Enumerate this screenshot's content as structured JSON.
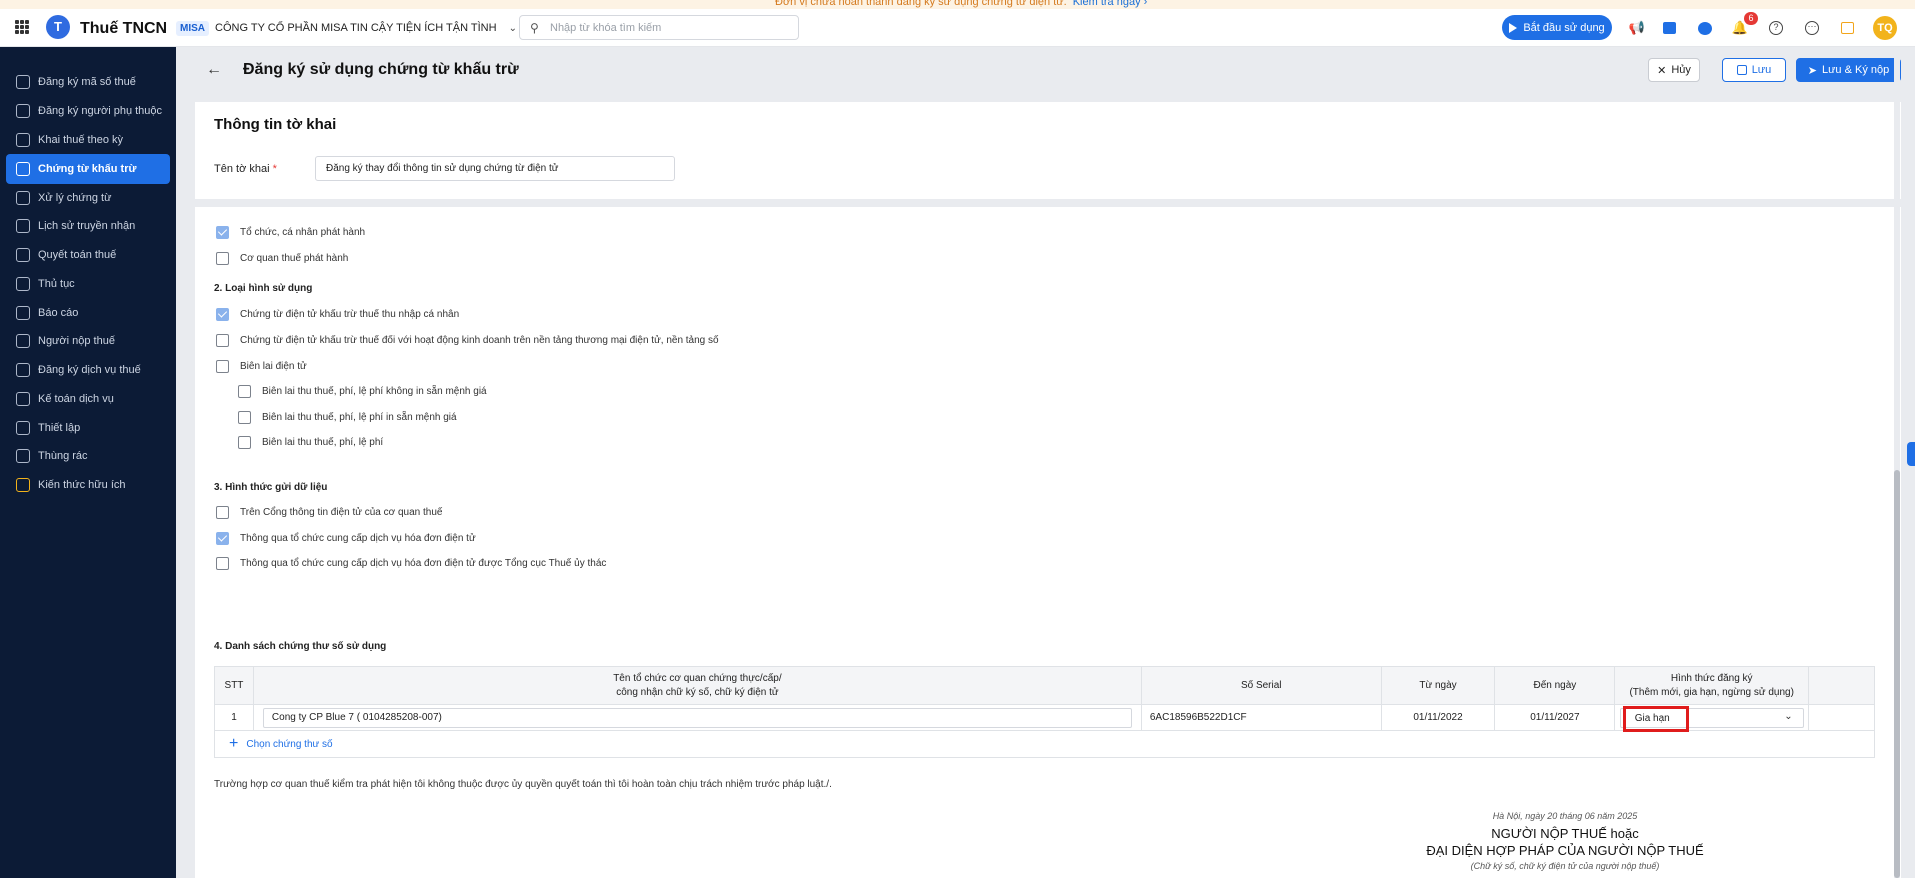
{
  "notice": {
    "text": "Đơn vị chưa hoàn thành đăng ký sử dụng chứng từ điện tử.",
    "link": "Kiểm tra ngay ›"
  },
  "header": {
    "app_title": "Thuế TNCN",
    "logo_letter": "T",
    "company_tag": "MISA",
    "company_name": "CÔNG TY CỔ PHẦN MISA TIN CẬY TIỆN ÍCH TẬN TÌNH",
    "search_placeholder": "Nhập từ khóa tìm kiếm",
    "start_label": "Bắt đầu sử dụng",
    "notification_count": "6",
    "avatar_initials": "TQ"
  },
  "sidebar": {
    "items": [
      {
        "label": "Đăng ký mã số thuế"
      },
      {
        "label": "Đăng ký người phụ thuộc"
      },
      {
        "label": "Khai thuế theo kỳ"
      },
      {
        "label": "Chứng từ khấu trừ"
      },
      {
        "label": "Xử lý chứng từ"
      },
      {
        "label": "Lịch sử truyền nhận"
      },
      {
        "label": "Quyết toán thuế"
      },
      {
        "label": "Thủ tục"
      },
      {
        "label": "Báo cáo"
      },
      {
        "label": "Người nộp thuế"
      },
      {
        "label": "Đăng ký dịch vụ thuế"
      },
      {
        "label": "Kế toán dịch vụ"
      },
      {
        "label": "Thiết lập"
      },
      {
        "label": "Thùng rác"
      },
      {
        "label": "Kiến thức hữu ích"
      }
    ]
  },
  "page": {
    "title": "Đăng ký sử dụng chứng từ khấu trừ",
    "cancel_label": "Hủy",
    "save_label": "Lưu",
    "submit_label": "Lưu & Ký nộp"
  },
  "info": {
    "section_title": "Thông tin tờ khai",
    "name_label": "Tên tờ khai",
    "required_mark": "*",
    "name_value": "Đăng ký thay đổi thông tin sử dụng chứng từ điện tử"
  },
  "form": {
    "issuer": {
      "options": [
        {
          "label": "Tổ chức, cá nhân phát hành",
          "checked": true
        },
        {
          "label": "Cơ quan thuế phát hành",
          "checked": false
        }
      ]
    },
    "usage": {
      "title": "2. Loại hình sử dụng",
      "options": [
        {
          "label": "Chứng từ điện tử khấu trừ thuế thu nhập cá nhân",
          "checked": true
        },
        {
          "label": "Chứng từ điện tử khấu trừ thuế đối với hoạt động kinh doanh trên nền tảng thương mại điện tử, nền tảng số",
          "checked": false
        },
        {
          "label": "Biên lai điện tử",
          "checked": false
        }
      ],
      "sub_options": [
        {
          "label": "Biên lai thu thuế, phí, lệ phí không in sẵn mệnh giá",
          "checked": false
        },
        {
          "label": "Biên lai thu thuế, phí, lệ phí in sẵn mệnh giá",
          "checked": false
        },
        {
          "label": "Biên lai thu thuế, phí, lệ phí",
          "checked": false
        }
      ]
    },
    "send": {
      "title": "3. Hình thức gửi dữ liệu",
      "options": [
        {
          "label": "Trên Cổng thông tin điện tử của cơ quan thuế",
          "checked": false
        },
        {
          "label": "Thông qua tổ chức cung cấp dịch vụ hóa đơn điện tử",
          "checked": true
        },
        {
          "label": "Thông qua tổ chức cung cấp dịch vụ hóa đơn điện tử được Tổng cục Thuế ủy thác",
          "checked": false
        }
      ]
    },
    "certs": {
      "title": "4. Danh sách chứng thư số sử dụng",
      "headers": {
        "stt": "STT",
        "org_line1": "Tên tổ chức cơ quan chứng thực/cấp/",
        "org_line2": "công nhận chữ ký số, chữ ký điện tử",
        "serial": "Số Serial",
        "from": "Từ ngày",
        "to": "Đến ngày",
        "type_line1": "Hình thức đăng ký",
        "type_line2": "(Thêm mới, gia hạn, ngừng sử dụng)"
      },
      "rows": [
        {
          "stt": "1",
          "org": "Cong ty CP Blue 7 ( 0104285208-007)",
          "serial": "6AC18596B522D1CF",
          "from": "01/11/2022",
          "to": "01/11/2027",
          "type": "Gia hạn"
        }
      ],
      "add_label": "Chọn chứng thư số"
    }
  },
  "footer": {
    "note": "Trường hợp cơ quan thuế kiểm tra phát hiện tôi không thuộc được ủy quyền quyết toán thì tôi hoàn toàn chịu trách nhiệm trước pháp luật./.",
    "date": "Hà Nội, ngày 20 tháng 06 năm 2025",
    "sign_line1": "NGƯỜI NỘP THUẾ hoặc",
    "sign_line2": "ĐẠI DIỆN HỢP PHÁP CỦA NGƯỜI NỘP THUẾ",
    "sign_sub": "(Chữ ký số, chữ ký điện tử của người nộp thuế)"
  },
  "colors": {
    "accent": "#1f6fe5",
    "sidebar_bg": "#0c1b36",
    "highlight": "#e01c1c"
  }
}
